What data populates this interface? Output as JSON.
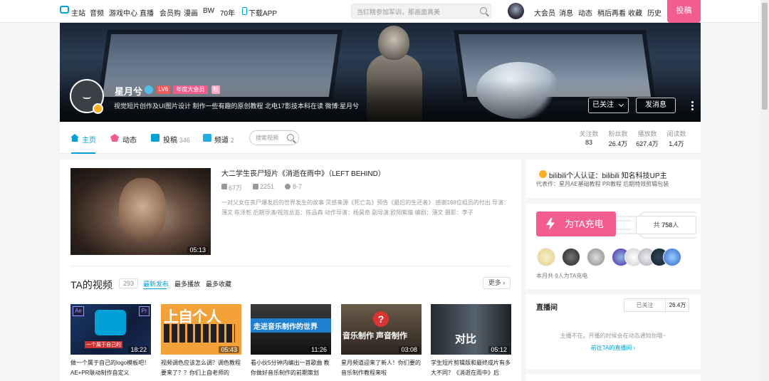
{
  "topnav": {
    "left_items": [
      "主站",
      "音频",
      "游戏中心",
      "直播",
      "会员购",
      "漫画",
      "BW",
      "70年"
    ],
    "download_label": "下载APP",
    "search_placeholder": "当红精参加军训，那画面真美",
    "right_items": [
      "大会员",
      "消息",
      "动态",
      "稍后再看",
      "收藏",
      "历史"
    ],
    "upload_label": "投稿"
  },
  "profile": {
    "username": "星月兮",
    "level": "LV6",
    "vip": "年度大会员",
    "tag": "粉",
    "sign": "视觉短片创作及UI图片设计 制作一些有趣的原创教程 北电17影技本科在读 微博:星月兮",
    "follow_label": "已关注",
    "message_label": "发消息"
  },
  "tabs": {
    "home": "主页",
    "dynamic": "动态",
    "video": "投稿",
    "video_count": "346",
    "channel": "频道",
    "channel_count": "2",
    "search_placeholder": "搜索视频"
  },
  "stats": [
    {
      "label": "关注数",
      "value": "83"
    },
    {
      "label": "粉丝数",
      "value": "26.4万"
    },
    {
      "label": "播放数",
      "value": "627.4万"
    },
    {
      "label": "阅读数",
      "value": "1.4万"
    }
  ],
  "featured": {
    "title": "大二学生丧尸短片《消逝在雨中》（LEFT BEHIND）",
    "duration": "05:13",
    "plays": "67万",
    "danmaku": "2251",
    "time": "8-7",
    "desc": "一对父女在丧尸爆发后的世界发生的故事 灵感来源《死亡岛》预告《最后的生还者》 感谢168位组员的付出 导演：薄文 陈泽乾 后期导演/视效总监：陈品森 动作导演：杨昊奇 副导演:欧阳紫璇 编剧：薄文 摄影：李子"
  },
  "videos_section": {
    "title": "TA的视频",
    "count": "293",
    "sort": [
      "最新发布",
      "最多播放",
      "最多收藏"
    ],
    "more": "更多"
  },
  "videos": [
    {
      "duration": "18:22",
      "title": "做一个属于自己的logo模板吧！AE+PR联动制作自定义",
      "thumb_text": "一个属于自己的"
    },
    {
      "duration": "05:43",
      "title": "视频调色应该怎么调？调色教程要来了？？你们上自老师的",
      "thumb_text": "上自个人"
    },
    {
      "duration": "11:26",
      "title": "看小伙5分钟内编出一首歌曲 教你做好音乐制作的前期策划",
      "thumb_text": "走进音乐制作的世界"
    },
    {
      "duration": "03:08",
      "title": "星月频道迎来了新人！你们要的音乐制作教程来啦",
      "thumb_text": "音乐制作 声音制作"
    },
    {
      "duration": "05:12",
      "title": "学生短片剪辑版和最终成片有多大不同？《消逝在雨中》后",
      "thumb_text": "对比"
    }
  ],
  "certification": {
    "title": "bilibili个人认证：bilibili 知名科技UP主",
    "works": "代表作：星月AE基础教程 PR教程 后期特效剪辑包装"
  },
  "charge": {
    "button": "为TA充电",
    "total_prefix": "共",
    "total": "758",
    "total_suffix": "人",
    "note": "本月共 9人为TA充电"
  },
  "live": {
    "title": "直播间",
    "follow": "已关注",
    "fans": "26.4万",
    "message": "主播不在。开播的时候会在动态通知你哦~",
    "link": "前往TA的直播间"
  },
  "colors": {
    "brand_blue": "#00a1d6",
    "brand_pink": "#f25d8e",
    "background": "#f4f5f7"
  }
}
